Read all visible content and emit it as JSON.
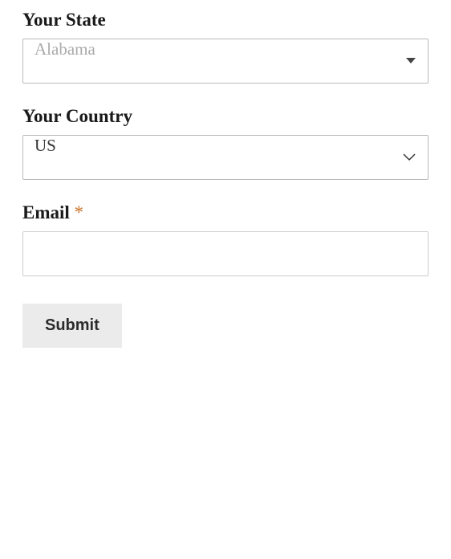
{
  "form": {
    "state": {
      "label": "Your State",
      "placeholder": "Alabama"
    },
    "country": {
      "label": "Your Country",
      "value": "US"
    },
    "email": {
      "label": "Email",
      "required_mark": "*",
      "value": ""
    },
    "submit": {
      "label": "Submit"
    }
  }
}
